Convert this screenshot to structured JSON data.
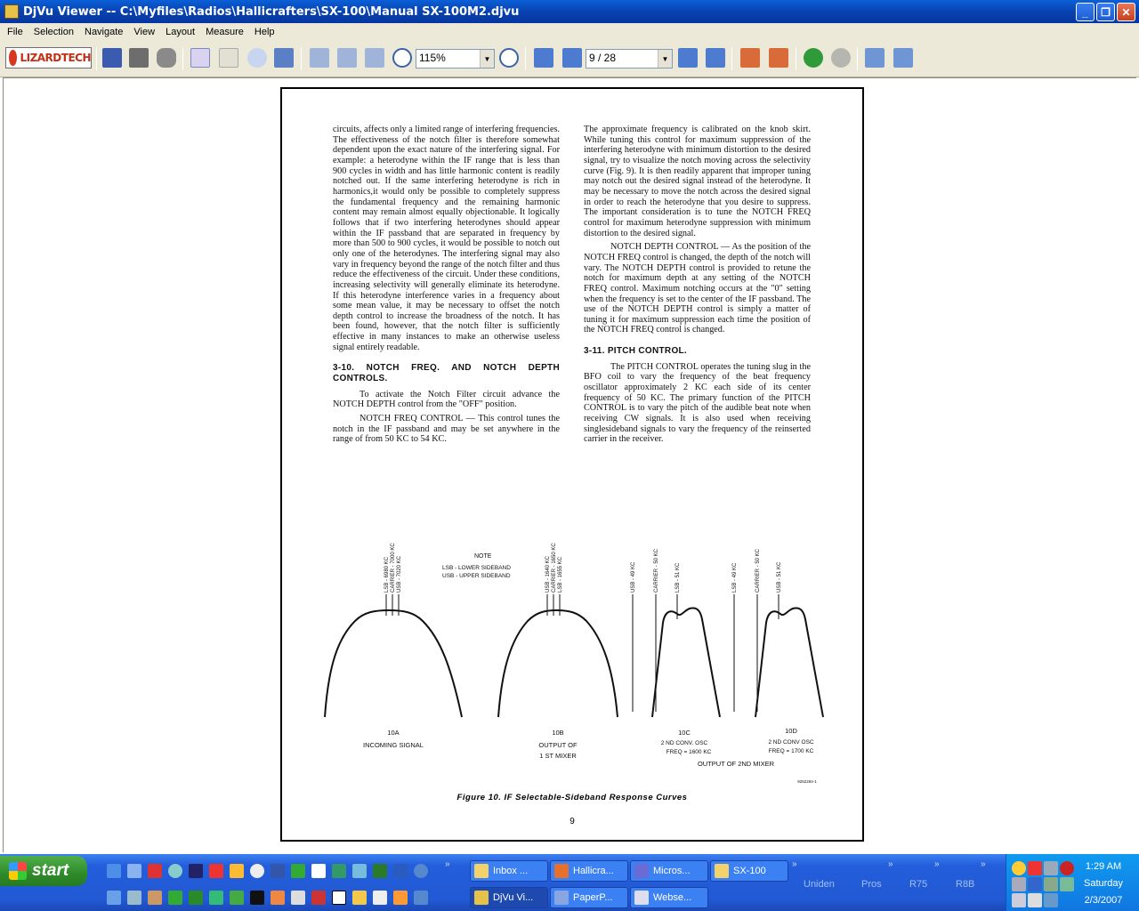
{
  "window": {
    "title": "DjVu Viewer -- C:\\Myfiles\\Radios\\Hallicrafters\\SX-100\\Manual SX-100M2.djvu",
    "minimize": "_",
    "maximize": "❐",
    "close": "✕"
  },
  "menu": [
    "File",
    "Selection",
    "Navigate",
    "View",
    "Layout",
    "Measure",
    "Help"
  ],
  "toolbar": {
    "logo_text": "LIZARDTECH",
    "zoom_value": "115%",
    "page_value": "9 / 28"
  },
  "document": {
    "left_column": [
      "circuits, affects only a limited range of interfering frequencies. The effectiveness of the notch filter is therefore somewhat dependent upon the exact nature of the interfering signal. For example: a heterodyne within the IF range that is less than 900 cycles in width and has little harmonic content is readily notched out. If the same interfering heterodyne is rich in harmonics,it would only be possible to completely suppress the fundamental frequency and the remaining harmonic content may remain almost equally objectionable. It logically follows that if two interfering heterodynes should appear within the IF passband that are separated in frequency by more than 500 to 900 cycles, it would be possible to notch out only one of the heterodynes. The interfering signal may also vary in frequency beyond the range of the notch filter and thus reduce the effectiveness of the circuit. Under these conditions, increasing selectivity will generally eliminate its heterodyne. If this heterodyne interference varies in a frequency about some mean value, it may be necessary to offset the notch depth control to increase the broadness of the notch. It has been found, however, that the notch filter is sufficiently effective in many instances to make an otherwise useless signal entirely readable."
    ],
    "heading_310": "3-10.  NOTCH FREQ. AND NOTCH DEPTH CONTROLS.",
    "left_after": [
      "To activate the Notch Filter circuit advance the NOTCH DEPTH control from the \"OFF\" position.",
      "NOTCH FREQ CONTROL — This control tunes the notch in the IF passband and may be set anywhere in the range of from 50 KC to 54 KC."
    ],
    "right_column": [
      "The approximate frequency is calibrated on the knob skirt. While tuning this control for maximum suppression of the interfering heterodyne with minimum distortion to the desired signal, try to visualize the notch moving across the selectivity curve (Fig. 9). It is then readily apparent that improper tuning may notch out the desired signal instead of the heterodyne. It may be necessary to move the notch across the desired signal in order to reach the heterodyne that you desire to suppress. The important consideration is to tune the NOTCH FREQ control for maximum heterodyne suppression with minimum distortion to the desired signal.",
      "NOTCH DEPTH CONTROL — As the position of the NOTCH FREQ control is changed, the depth of the notch will vary. The NOTCH DEPTH control is provided to retune the notch for maximum depth at any setting of the NOTCH FREQ control. Maximum notching occurs at the \"0\" setting when the frequency is set to the center of the IF passband. The use of the NOTCH DEPTH control is simply a matter of tuning it for maximum suppression each time the position of the NOTCH FREQ control is changed."
    ],
    "heading_311": "3-11.  PITCH CONTROL.",
    "right_after": [
      "The PITCH CONTROL operates the tuning slug in the BFO coil to vary the frequency of the beat frequency oscillator approximately 2 KC each side of its center frequency of 50 KC. The primary function of the PITCH CONTROL is to vary the pitch of the audible beat note when receiving CW signals. It is also used when receiving singlesideband signals to vary the frequency of the reinserted carrier in the receiver."
    ],
    "figure": {
      "note_title": "NOTE",
      "note_lines": [
        "LSB - LOWER SIDEBAND",
        "USB - UPPER SIDEBAND"
      ],
      "a_labels": [
        "LSB - 6980 KC",
        "CARRIER - 7000 KC",
        "USB - 7020 KC"
      ],
      "b_labels": [
        "USB - 1640 KC",
        "CARRIER - 1650 KC",
        "LSB - 1655 KC"
      ],
      "c_labels": [
        "USB - 49 KC",
        "CARRIER - 50 KC",
        "LSB - 51 KC"
      ],
      "d_labels": [
        "LSB - 49 KC",
        "CARRIER - 50 KC",
        "USB - 51 KC"
      ],
      "cap_a": [
        "10A",
        "INCOMING SIGNAL"
      ],
      "cap_b": [
        "10B",
        "OUTPUT OF",
        "1 ST MIXER"
      ],
      "cap_c": [
        "10C",
        "2 ND CONV. OSC",
        "FREQ = 1600 KC"
      ],
      "cap_d": [
        "10D",
        "2 ND CONV OSC",
        "FREQ = 1700 KC"
      ],
      "cap_cd": "OUTPUT OF 2ND MIXER",
      "part_no": "9252284-1",
      "caption": "Figure 10.  IF Selectable-Sideband Response Curves"
    },
    "page_number": "9"
  },
  "taskbar": {
    "start_label": "start",
    "tasks_top": [
      "Inbox ...",
      "Hallicra...",
      "Micros...",
      "SX-100"
    ],
    "tasks_bottom": [
      "DjVu Vi...",
      "PaperP...",
      "Webse..."
    ],
    "desk_bands": [
      "Uniden",
      "Pros",
      "R75",
      "R8B"
    ],
    "clock_time": "1:29 AM",
    "clock_day": "Saturday",
    "clock_date": "2/3/2007"
  }
}
